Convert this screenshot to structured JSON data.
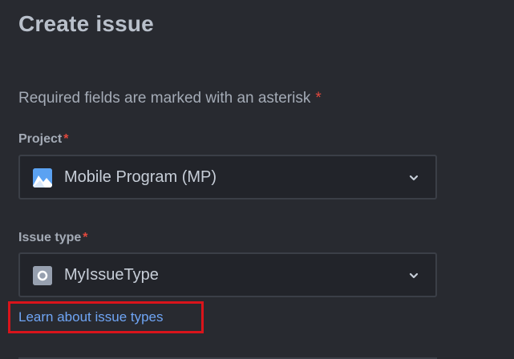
{
  "dialog": {
    "title": "Create issue",
    "required_note": "Required fields are marked with an asterisk",
    "required_marker": "*"
  },
  "fields": {
    "project": {
      "label": "Project",
      "required_marker": "*",
      "value": "Mobile Program (MP)",
      "icon": "project-avatar-icon",
      "icon_color": "#5ba2f2"
    },
    "issue_type": {
      "label": "Issue type",
      "required_marker": "*",
      "value": "MyIssueType",
      "icon": "issue-type-icon",
      "icon_color": "#97a0af"
    }
  },
  "links": {
    "learn_issue_types": "Learn about issue types"
  },
  "colors": {
    "background": "#282a30",
    "field_background": "#22242a",
    "link": "#6fa5f5",
    "asterisk": "#e2483d",
    "highlight": "#d9141b"
  }
}
